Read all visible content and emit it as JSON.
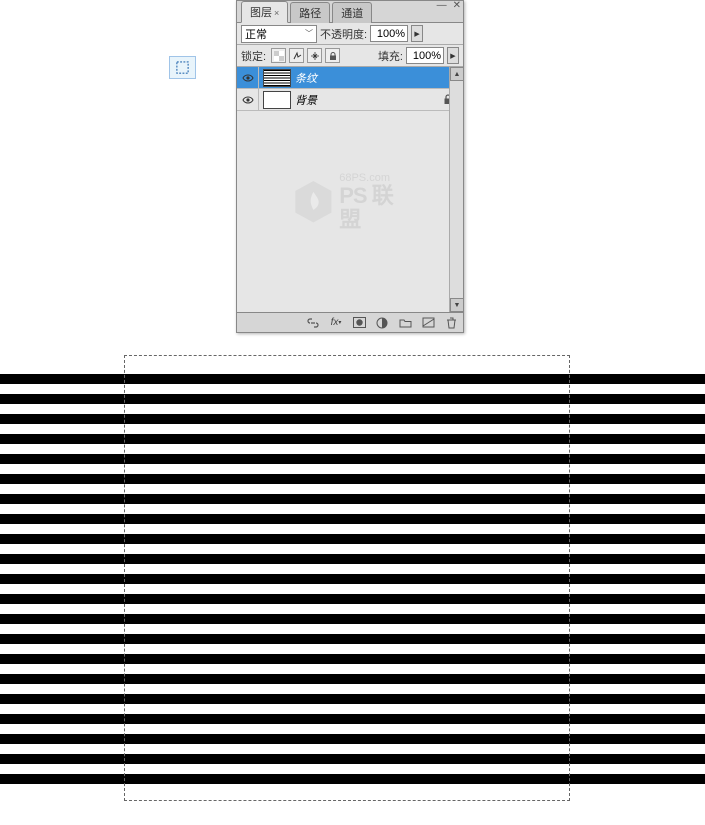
{
  "panel": {
    "tabs": [
      {
        "label": "图层",
        "active": true,
        "closable": true
      },
      {
        "label": "路径",
        "active": false
      },
      {
        "label": "通道",
        "active": false
      }
    ],
    "blend_mode": "正常",
    "opacity_label": "不透明度:",
    "opacity_value": "100%",
    "lock_label": "锁定:",
    "fill_label": "填充:",
    "fill_value": "100%",
    "layers": [
      {
        "visible": true,
        "name": "条纹",
        "selected": true,
        "thumb": "stripes",
        "locked": false
      },
      {
        "visible": true,
        "name": "背景",
        "selected": false,
        "thumb": "white",
        "locked": true,
        "italic": true
      }
    ],
    "watermark": {
      "domain": "68PS.com",
      "brand": "PS 联盟"
    }
  }
}
